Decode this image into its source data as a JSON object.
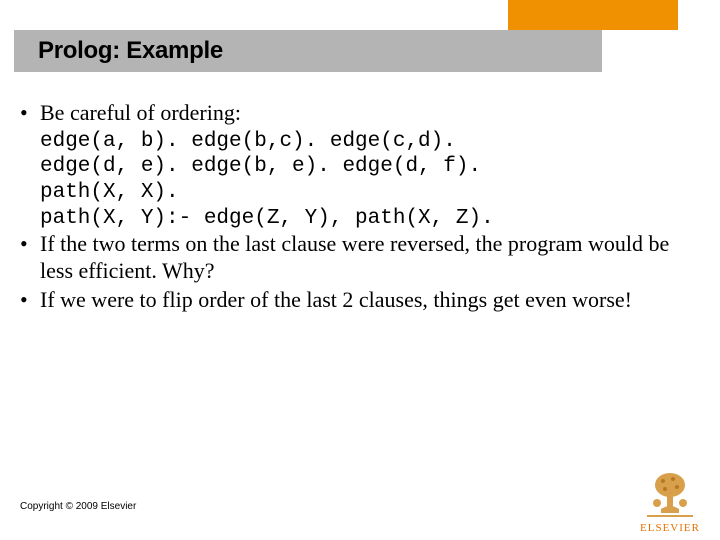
{
  "header": {
    "title": "Prolog: Example"
  },
  "content": {
    "bullet1": "Be careful of ordering:",
    "code_lines": [
      "edge(a, b). edge(b,c). edge(c,d).",
      "edge(d, e). edge(b, e). edge(d, f).",
      "path(X, X).",
      "path(X, Y):- edge(Z, Y), path(X, Z)."
    ],
    "bullet2": "If the two terms on the last clause were reversed, the program would be less efficient.  Why?",
    "bullet3": "If we were to flip order of the last 2 clauses, things get even worse!"
  },
  "footer": {
    "copyright": "Copyright © 2009 Elsevier",
    "logo_label": "ELSEVIER"
  }
}
